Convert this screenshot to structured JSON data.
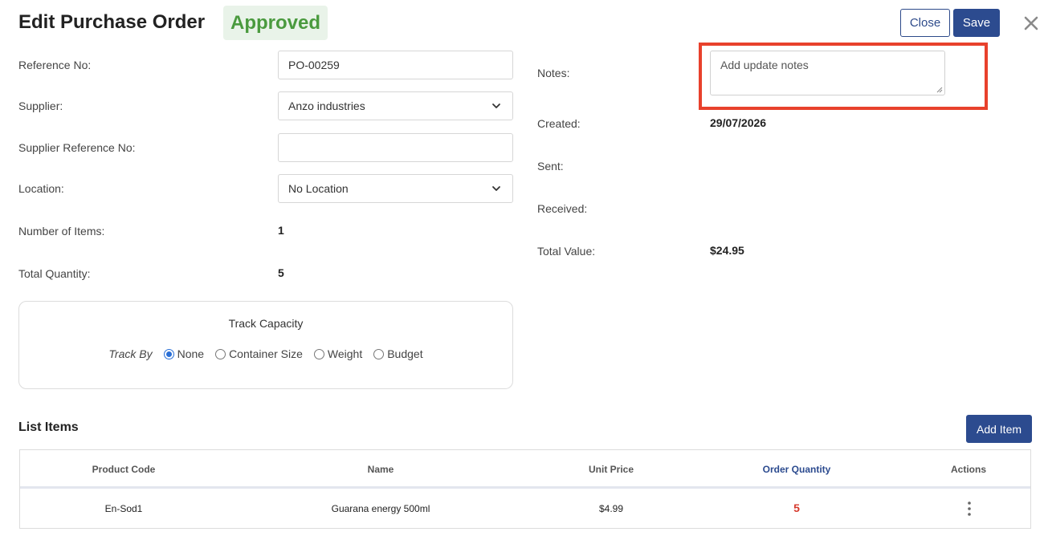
{
  "header": {
    "title": "Edit Purchase Order",
    "status": "Approved",
    "close_label": "Close",
    "save_label": "Save",
    "dismiss_icon": "close-icon"
  },
  "form_left": {
    "reference_label": "Reference No:",
    "reference_value": "PO-00259",
    "supplier_label": "Supplier:",
    "supplier_value": "Anzo industries",
    "supplier_ref_label": "Supplier Reference No:",
    "supplier_ref_value": "",
    "location_label": "Location:",
    "location_value": "No Location",
    "items_label": "Number of Items:",
    "items_value": "1",
    "quantity_label": "Total Quantity:",
    "quantity_value": "5"
  },
  "form_right": {
    "notes_label": "Notes:",
    "notes_placeholder": "Add update notes",
    "created_label": "Created:",
    "created_value": "29/07/2026",
    "sent_label": "Sent:",
    "sent_value": "",
    "received_label": "Received:",
    "received_value": "",
    "total_value_label": "Total Value:",
    "total_value": "$24.95"
  },
  "track_capacity": {
    "title": "Track Capacity",
    "track_by_label": "Track By",
    "options": [
      "None",
      "Container Size",
      "Weight",
      "Budget"
    ],
    "selected": "None"
  },
  "list": {
    "title": "List Items",
    "add_label": "Add Item",
    "columns": [
      "Product Code",
      "Name",
      "Unit Price",
      "Order Quantity",
      "Actions"
    ],
    "rows": [
      {
        "product_code": "En-Sod1",
        "name": "Guarana energy 500ml",
        "unit_price": "$4.99",
        "order_quantity": "5"
      }
    ]
  },
  "colors": {
    "primary": "#2c4b8f",
    "approved_text": "#4a9a3e",
    "approved_bg": "#e9f3e9",
    "highlight": "#e8412c",
    "quantity": "#d63a2d"
  }
}
